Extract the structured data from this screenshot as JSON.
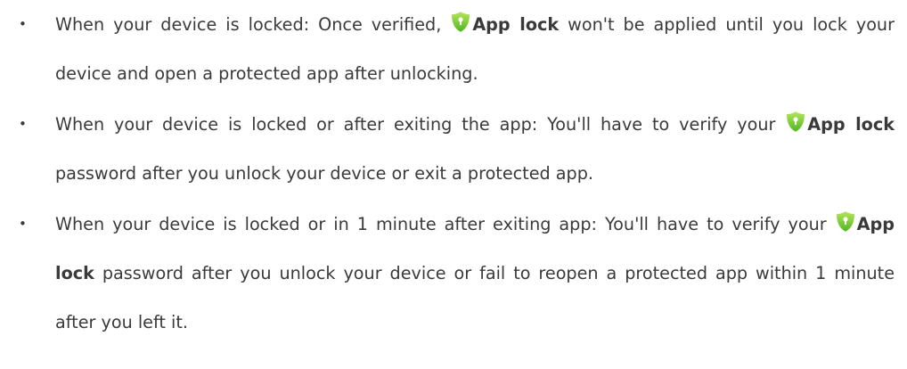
{
  "items": [
    {
      "before": "When your device is locked: Once verified, ",
      "app_name": "App lock",
      "after": " won't be applied until you lock your device and open a protected app after unlocking."
    },
    {
      "before": "When your device is locked or after exiting the app: You'll have to verify your ",
      "app_name": "App lock",
      "after": " password after you unlock your device or exit a protected app."
    },
    {
      "before": "When your device is locked or in 1 minute after exiting app: You'll have to verify your ",
      "app_name": "App lock",
      "after": " password after you unlock your device or fail to reopen a protected app within 1 minute after you left it."
    }
  ],
  "bullet_symbol": "•",
  "icon": {
    "name": "app-lock-shield-icon",
    "color_top": "#b6e45a",
    "color_bottom": "#4fb81f"
  }
}
